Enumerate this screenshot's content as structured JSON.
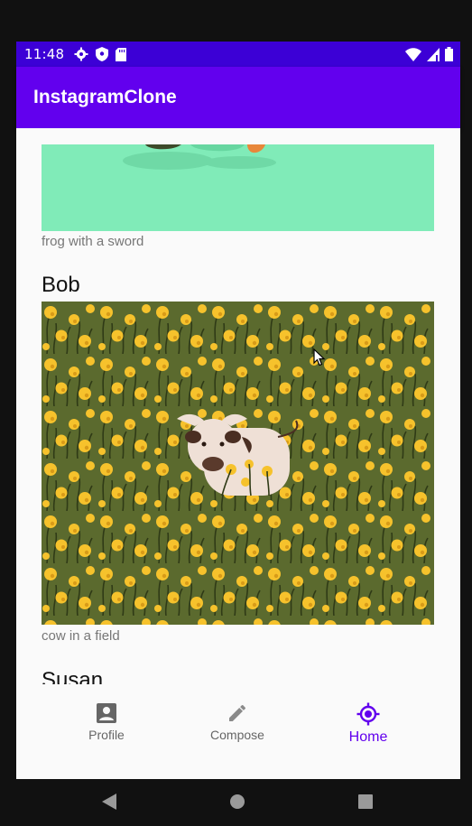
{
  "status_bar": {
    "time": "11:48",
    "icons_left": [
      "settings-icon",
      "shield-icon",
      "sd-card-icon"
    ],
    "icons_right": [
      "wifi-icon",
      "signal-icon",
      "battery-icon"
    ]
  },
  "app_bar": {
    "title": "InstagramClone"
  },
  "feed": {
    "posts": [
      {
        "username": "",
        "caption": "frog with a sword",
        "image": "frog-illustration"
      },
      {
        "username": "Bob",
        "caption": "cow in a field",
        "image": "cow-in-flower-field-illustration"
      },
      {
        "username": "Susan",
        "caption": "",
        "image": ""
      }
    ]
  },
  "bottom_nav": {
    "items": [
      {
        "label": "Profile",
        "icon": "account-box-icon",
        "active": false
      },
      {
        "label": "Compose",
        "icon": "pencil-icon",
        "active": false
      },
      {
        "label": "Home",
        "icon": "gps-target-icon",
        "active": true
      }
    ]
  },
  "colors": {
    "primary": "#6200ee",
    "primary_dark": "#3c00d6",
    "frog_bg": "#80ebb8",
    "field_green": "#5b6a2e",
    "flower_yellow": "#f6c22c"
  }
}
